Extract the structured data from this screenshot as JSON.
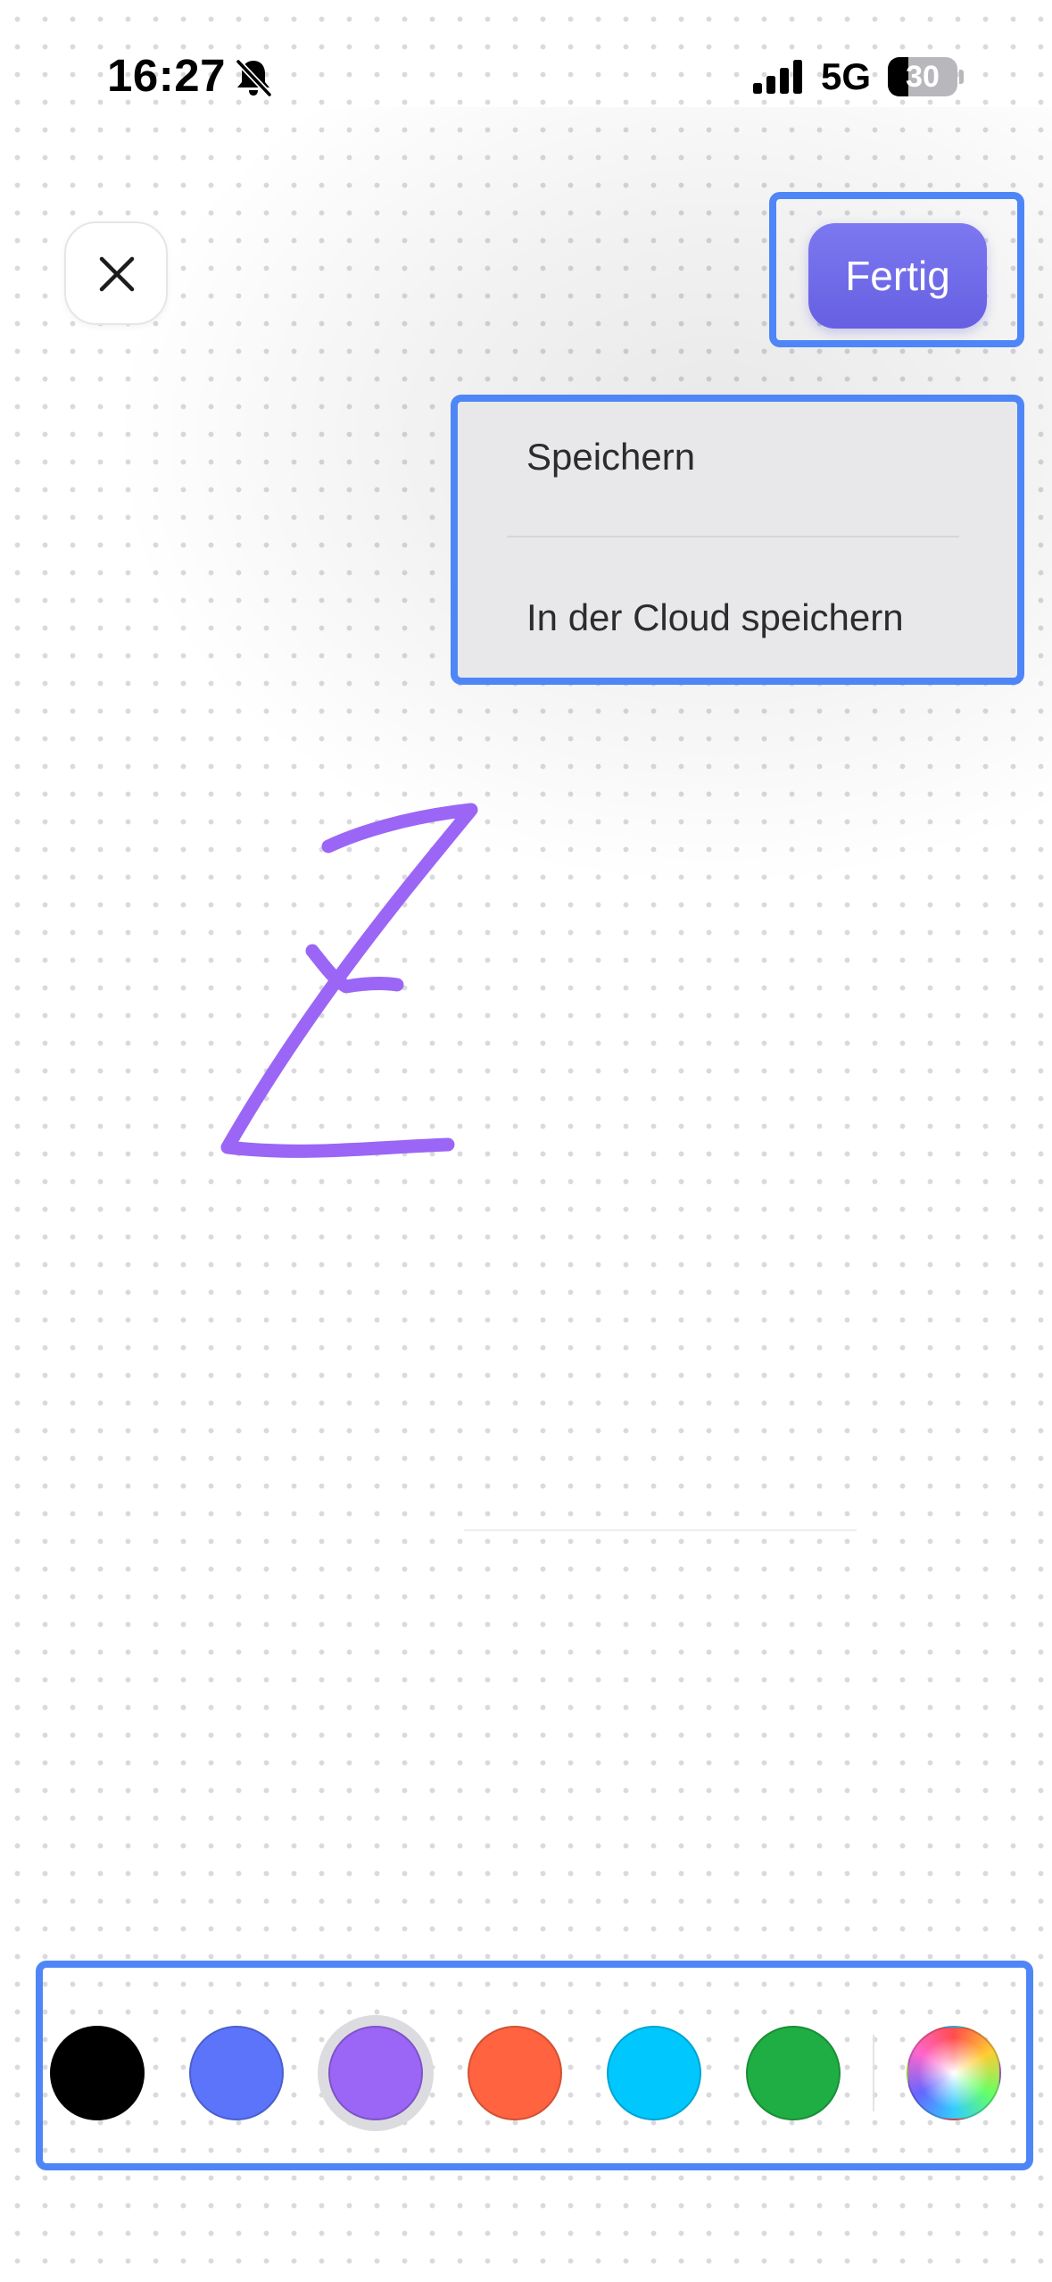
{
  "status_bar": {
    "time": "16:27",
    "network": "5G",
    "battery_level": "30",
    "battery_fraction": 0.3,
    "icons": [
      "bell-slash-icon",
      "cellular-signal-icon",
      "battery-icon"
    ]
  },
  "toolbar": {
    "close_icon": "close-icon",
    "done_label": "Fertig"
  },
  "save_menu": {
    "items": [
      {
        "label": "Speichern"
      },
      {
        "label": "In der Cloud speichern"
      }
    ]
  },
  "canvas": {
    "stroke_color": "#9b66f5",
    "glyph": "Z"
  },
  "palette": {
    "colors": [
      {
        "name": "black",
        "hex": "#000000",
        "selected": false
      },
      {
        "name": "blue",
        "hex": "#5b74fa",
        "selected": false
      },
      {
        "name": "purple",
        "hex": "#9b66f5",
        "selected": true
      },
      {
        "name": "orange",
        "hex": "#ff6340",
        "selected": false
      },
      {
        "name": "cyan",
        "hex": "#00c8ff",
        "selected": false
      },
      {
        "name": "green",
        "hex": "#1fae44",
        "selected": false
      },
      {
        "name": "custom",
        "hex": "multicolor",
        "selected": false
      }
    ]
  },
  "colors": {
    "accent": "#6a64e6",
    "highlight": "#4f86f7",
    "menu_background": "#e8e8ea"
  }
}
